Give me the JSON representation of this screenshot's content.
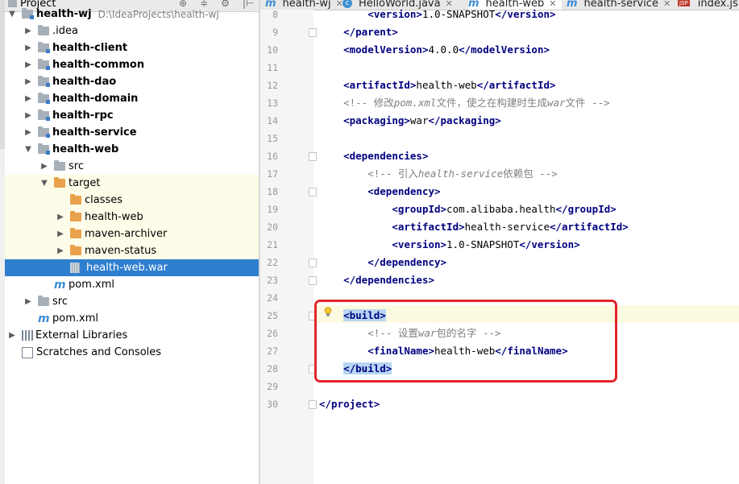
{
  "panel": {
    "title": "Project",
    "tools": [
      "⊕",
      "≑",
      "⚙",
      "|⊢"
    ]
  },
  "tree": [
    {
      "label": "health-wj",
      "path": "D:\\IdeaProjects\\health-wj",
      "bold": true,
      "arrow": "down",
      "icon": "module",
      "indent": 0
    },
    {
      "label": ".idea",
      "arrow": "right",
      "icon": "grey",
      "indent": 1
    },
    {
      "label": "health-client",
      "bold": true,
      "arrow": "right",
      "icon": "module",
      "indent": 1
    },
    {
      "label": "health-common",
      "bold": true,
      "arrow": "right",
      "icon": "module",
      "indent": 1
    },
    {
      "label": "health-dao",
      "bold": true,
      "arrow": "right",
      "icon": "module",
      "indent": 1
    },
    {
      "label": "health-domain",
      "bold": true,
      "arrow": "right",
      "icon": "module",
      "indent": 1
    },
    {
      "label": "health-rpc",
      "bold": true,
      "arrow": "right",
      "icon": "module",
      "indent": 1
    },
    {
      "label": "health-service",
      "bold": true,
      "arrow": "right",
      "icon": "module",
      "indent": 1
    },
    {
      "label": "health-web",
      "bold": true,
      "arrow": "down",
      "icon": "module",
      "indent": 1
    },
    {
      "label": "src",
      "arrow": "right",
      "icon": "grey",
      "indent": 2
    },
    {
      "label": "target",
      "arrow": "down",
      "icon": "orange",
      "indent": 2,
      "excluded": true
    },
    {
      "label": "classes",
      "arrow": "",
      "icon": "orange",
      "indent": 3,
      "excluded": true
    },
    {
      "label": "health-web",
      "arrow": "right",
      "icon": "orange",
      "indent": 3,
      "excluded": true
    },
    {
      "label": "maven-archiver",
      "arrow": "right",
      "icon": "orange",
      "indent": 3,
      "excluded": true
    },
    {
      "label": "maven-status",
      "arrow": "right",
      "icon": "orange",
      "indent": 3,
      "excluded": true
    },
    {
      "label": "health-web.war",
      "arrow": "",
      "icon": "war",
      "indent": 3,
      "selected": true
    },
    {
      "label": "pom.xml",
      "arrow": "",
      "icon": "m",
      "indent": 2
    },
    {
      "label": "src",
      "arrow": "right",
      "icon": "grey",
      "indent": 1
    },
    {
      "label": "pom.xml",
      "arrow": "",
      "icon": "m",
      "indent": 1
    },
    {
      "label": "External Libraries",
      "arrow": "right",
      "icon": "lib",
      "indent": 0
    },
    {
      "label": "Scratches and Consoles",
      "arrow": "",
      "icon": "scratch",
      "indent": 0
    }
  ],
  "tabs": [
    {
      "label": "health-wj",
      "icon": "m",
      "active": false
    },
    {
      "label": "HelloWorld.java",
      "icon": "c",
      "active": false
    },
    {
      "label": "health-web",
      "icon": "m",
      "active": true
    },
    {
      "label": "health-service",
      "icon": "m",
      "active": false
    },
    {
      "label": "index.jsp",
      "icon": "jsp",
      "active": false
    }
  ],
  "editor": {
    "lines": [
      {
        "no": "8",
        "parts": [
          [
            "pad",
            "        "
          ],
          [
            "tag",
            "<version>"
          ],
          [
            "txt",
            "1.0-SNAPSHOT"
          ],
          [
            "tag",
            "</version>"
          ]
        ]
      },
      {
        "no": "9",
        "parts": [
          [
            "pad",
            "    "
          ],
          [
            "tag",
            "</parent>"
          ]
        ]
      },
      {
        "no": "10",
        "parts": [
          [
            "pad",
            "    "
          ],
          [
            "tag",
            "<modelVersion>"
          ],
          [
            "txt",
            "4.0.0"
          ],
          [
            "tag",
            "</modelVersion>"
          ]
        ]
      },
      {
        "no": "11",
        "parts": []
      },
      {
        "no": "12",
        "parts": [
          [
            "pad",
            "    "
          ],
          [
            "tag",
            "<artifactId>"
          ],
          [
            "txt",
            "health-web"
          ],
          [
            "tag",
            "</artifactId>"
          ]
        ]
      },
      {
        "no": "13",
        "parts": [
          [
            "pad",
            "    "
          ],
          [
            "cmt-en",
            "<!-- 修改"
          ],
          [
            "cmt",
            "pom.xml"
          ],
          [
            "cmt-en",
            "文件，使之在构建时生成"
          ],
          [
            "cmt",
            "war"
          ],
          [
            "cmt-en",
            "文件 -->"
          ]
        ]
      },
      {
        "no": "14",
        "parts": [
          [
            "pad",
            "    "
          ],
          [
            "tag",
            "<packaging>"
          ],
          [
            "txt",
            "war"
          ],
          [
            "tag",
            "</packaging>"
          ]
        ]
      },
      {
        "no": "15",
        "parts": []
      },
      {
        "no": "16",
        "parts": [
          [
            "pad",
            "    "
          ],
          [
            "tag",
            "<dependencies>"
          ]
        ]
      },
      {
        "no": "17",
        "parts": [
          [
            "pad",
            "        "
          ],
          [
            "cmt-en",
            "<!-- 引入"
          ],
          [
            "cmt",
            "health-service"
          ],
          [
            "cmt-en",
            "依赖包 -->"
          ]
        ]
      },
      {
        "no": "18",
        "parts": [
          [
            "pad",
            "        "
          ],
          [
            "tag",
            "<dependency>"
          ]
        ]
      },
      {
        "no": "19",
        "parts": [
          [
            "pad",
            "            "
          ],
          [
            "tag",
            "<groupId>"
          ],
          [
            "txt",
            "com.alibaba.health"
          ],
          [
            "tag",
            "</groupId>"
          ]
        ]
      },
      {
        "no": "20",
        "parts": [
          [
            "pad",
            "            "
          ],
          [
            "tag",
            "<artifactId>"
          ],
          [
            "txt",
            "health-service"
          ],
          [
            "tag",
            "</artifactId>"
          ]
        ]
      },
      {
        "no": "21",
        "parts": [
          [
            "pad",
            "            "
          ],
          [
            "tag",
            "<version>"
          ],
          [
            "txt",
            "1.0-SNAPSHOT"
          ],
          [
            "tag",
            "</version>"
          ]
        ]
      },
      {
        "no": "22",
        "parts": [
          [
            "pad",
            "        "
          ],
          [
            "tag",
            "</dependency>"
          ]
        ]
      },
      {
        "no": "23",
        "parts": [
          [
            "pad",
            "    "
          ],
          [
            "tag",
            "</dependencies>"
          ]
        ]
      },
      {
        "no": "24",
        "parts": []
      },
      {
        "no": "25",
        "parts": [
          [
            "pad",
            "    "
          ],
          [
            "tag-hl",
            "<build>"
          ]
        ]
      },
      {
        "no": "26",
        "parts": [
          [
            "pad",
            "        "
          ],
          [
            "cmt-en",
            "<!-- 设置"
          ],
          [
            "cmt",
            "war"
          ],
          [
            "cmt-en",
            "包的名字 -->"
          ]
        ]
      },
      {
        "no": "27",
        "parts": [
          [
            "pad",
            "        "
          ],
          [
            "tag",
            "<finalName>"
          ],
          [
            "txt",
            "health-web"
          ],
          [
            "tag",
            "</finalName>"
          ]
        ]
      },
      {
        "no": "28",
        "parts": [
          [
            "pad",
            "    "
          ],
          [
            "tag-hl",
            "</build>"
          ]
        ]
      },
      {
        "no": "29",
        "parts": []
      },
      {
        "no": "30",
        "parts": [
          [
            "tag",
            "</project>"
          ]
        ]
      }
    ]
  },
  "colors": {
    "accent": "#2f7fcf",
    "highlight_box": "#e2252b",
    "tag": "#000080",
    "comment": "#808080"
  }
}
